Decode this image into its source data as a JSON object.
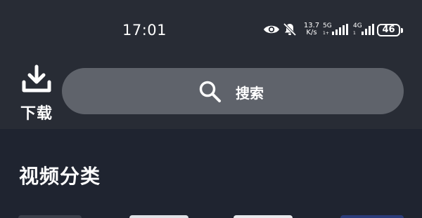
{
  "status_bar": {
    "time": "17:01",
    "net_speed_value": "13.7",
    "net_speed_unit": "K/s",
    "signal1_label": "5G",
    "signal1_sub": "1+",
    "signal2_label": "4G",
    "signal2_sub": "1",
    "battery_level": "46"
  },
  "header": {
    "download_label": "下载",
    "search_label": "搜索"
  },
  "section": {
    "title": "视频分类"
  }
}
